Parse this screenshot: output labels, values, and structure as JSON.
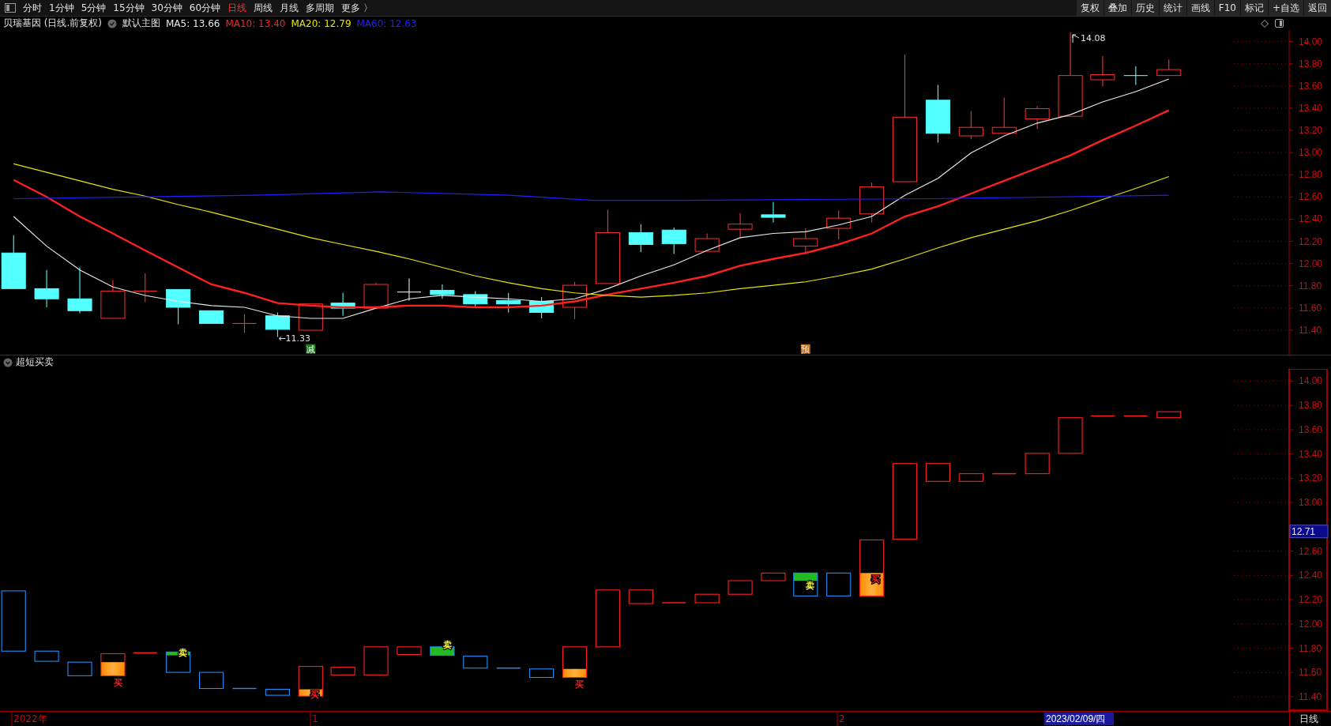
{
  "toolbar": {
    "periods": [
      {
        "label": "分时",
        "selected": false
      },
      {
        "label": "1分钟",
        "selected": false
      },
      {
        "label": "5分钟",
        "selected": false
      },
      {
        "label": "15分钟",
        "selected": false
      },
      {
        "label": "30分钟",
        "selected": false
      },
      {
        "label": "60分钟",
        "selected": false
      },
      {
        "label": "日线",
        "selected": true
      },
      {
        "label": "周线",
        "selected": false
      },
      {
        "label": "月线",
        "selected": false
      },
      {
        "label": "多周期",
        "selected": false
      },
      {
        "label": "更多 〉",
        "selected": false
      }
    ],
    "actions": [
      "复权",
      "叠加",
      "历史",
      "统计",
      "画线",
      "F10",
      "标记",
      "+自选",
      "返回"
    ]
  },
  "main_chart": {
    "title": "贝瑞基因 (日线.前复权)",
    "template": "默认主图",
    "indicators": [
      {
        "label": "MA5: 13.66",
        "color": "#e8e8e8"
      },
      {
        "label": "MA10: 13.40",
        "color": "#ff2020"
      },
      {
        "label": "MA20: 12.79",
        "color": "#e6e600"
      },
      {
        "label": "MA60: 12.63",
        "color": "#2020ff"
      }
    ],
    "y_labels": [
      "14.00",
      "13.80",
      "13.60",
      "13.40",
      "13.20",
      "13.00",
      "12.80",
      "12.60",
      "12.40",
      "12.20",
      "12.00",
      "11.80",
      "11.60",
      "11.40"
    ],
    "low_label": "←11.33",
    "high_label": "14.08",
    "markers": [
      {
        "label": "减",
        "kind": "reduce"
      },
      {
        "label": "预",
        "kind": "warn"
      }
    ]
  },
  "sub_chart": {
    "title": "超短买卖",
    "y_labels": [
      "14.00",
      "13.80",
      "13.60",
      "13.40",
      "13.20",
      "13.00",
      "12.60",
      "12.40",
      "12.20",
      "12.00",
      "11.80",
      "11.60",
      "11.40"
    ],
    "price_tag": "12.71",
    "signals": [
      {
        "label": "买",
        "kind": "buy"
      },
      {
        "label": "卖",
        "kind": "sell"
      },
      {
        "label": "买",
        "kind": "buy"
      },
      {
        "label": "卖",
        "kind": "sell"
      },
      {
        "label": "买",
        "kind": "buy"
      },
      {
        "label": "卖",
        "kind": "sell"
      },
      {
        "label": "买",
        "kind": "buy"
      }
    ]
  },
  "time_axis": {
    "labels": [
      "2022年",
      "1",
      "2"
    ],
    "cursor_date": "2023/02/09/四",
    "period": "日线"
  }
}
